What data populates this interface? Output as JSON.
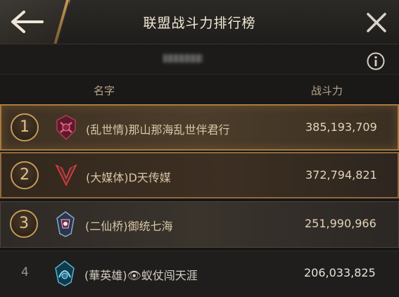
{
  "header": {
    "title": "联盟战斗力排行榜"
  },
  "columns": {
    "name": "名字",
    "power": "战斗力"
  },
  "rows": [
    {
      "rank": "1",
      "name": "(乱世情)那山那海乱世伴君行",
      "power": "385,193,709"
    },
    {
      "rank": "2",
      "name": "(大媒体)D天传媒",
      "power": "372,794,821"
    },
    {
      "rank": "3",
      "name": "(二仙桥)御统七海",
      "power": "251,990,966"
    },
    {
      "rank": "4",
      "name": "(華英雄)👁蚁仗闯天涯",
      "power": "206,033,825"
    }
  ],
  "colors": {
    "accent": "#c79a58",
    "background": "#161616",
    "title": "#f3e9d6"
  }
}
